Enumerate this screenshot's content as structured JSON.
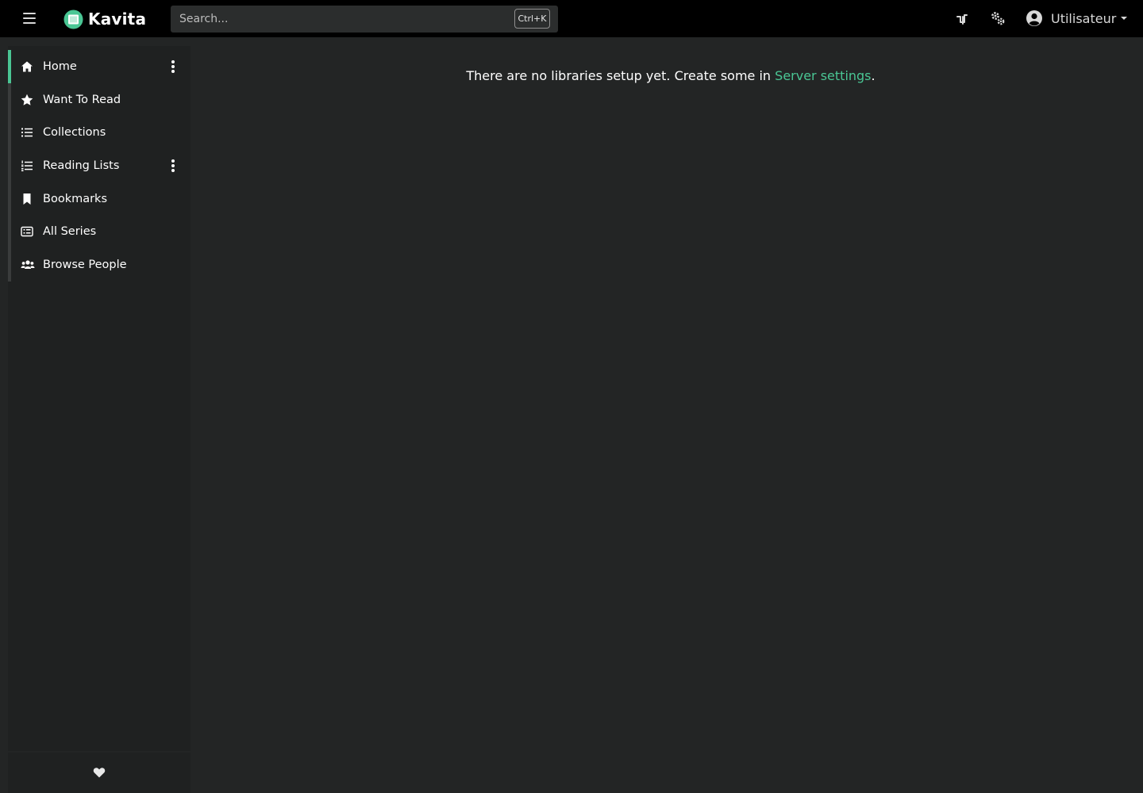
{
  "app": {
    "name": "Kavita",
    "accent_color": "#4ac694"
  },
  "topbar": {
    "menu_icon": "hamburger-icon",
    "search_placeholder": "Search...",
    "search_value": "",
    "search_shortcut": "Ctrl+K",
    "activity_icon": "activity-icon",
    "settings_icon": "server-settings-icon",
    "user": {
      "icon": "user-circle-icon",
      "name": "Utilisateur"
    }
  },
  "sidebar": {
    "items": [
      {
        "label": "Home",
        "icon": "home-icon",
        "active": true,
        "has_actions": true
      },
      {
        "label": "Want To Read",
        "icon": "star-icon",
        "active": false,
        "has_actions": false
      },
      {
        "label": "Collections",
        "icon": "list-icon",
        "active": false,
        "has_actions": false
      },
      {
        "label": "Reading Lists",
        "icon": "ordered-list-icon",
        "active": false,
        "has_actions": true
      },
      {
        "label": "Bookmarks",
        "icon": "bookmark-icon",
        "active": false,
        "has_actions": false
      },
      {
        "label": "All Series",
        "icon": "series-icon",
        "active": false,
        "has_actions": false
      },
      {
        "label": "Browse People",
        "icon": "people-icon",
        "active": false,
        "has_actions": false
      }
    ],
    "footer_icon": "heart-icon"
  },
  "main": {
    "message_prefix": "There are no libraries setup yet. Create some in ",
    "message_link": "Server settings",
    "message_suffix": "."
  }
}
